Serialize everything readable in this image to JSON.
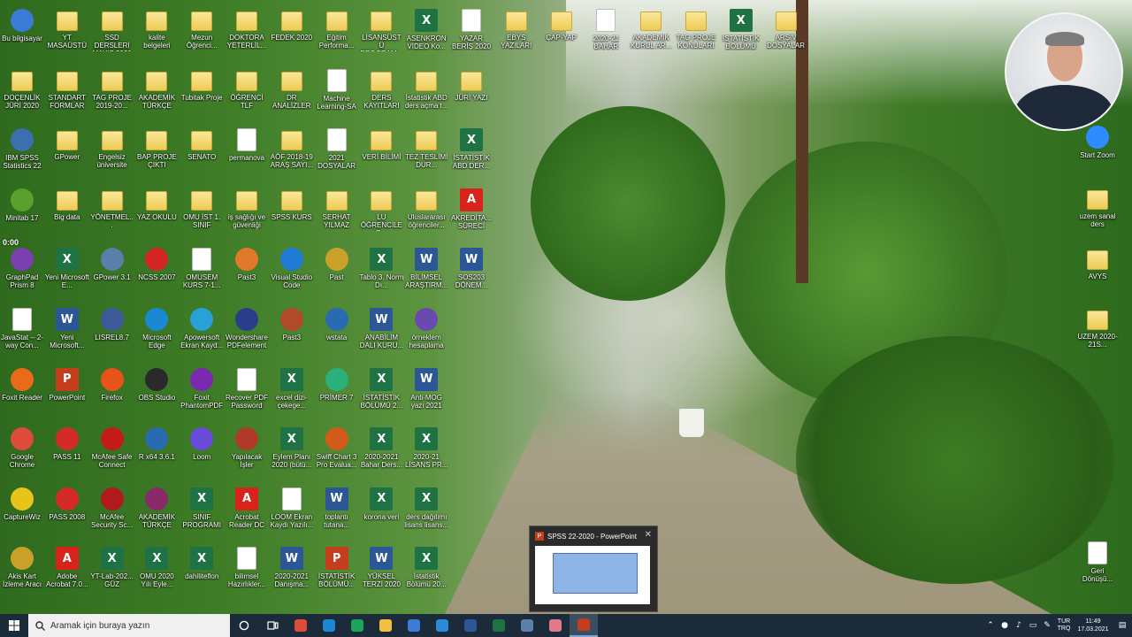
{
  "desktop": {
    "rows": [
      [
        {
          "label": "Bu bilgisayar",
          "type": "app",
          "color": "#3a7bd5"
        },
        {
          "label": "YT MASAÜSTÜ",
          "type": "folder"
        },
        {
          "label": "SSD DERSLERİ MAYIS 2020",
          "type": "folder"
        },
        {
          "label": "kalite belgeleri",
          "type": "folder"
        },
        {
          "label": "Mezun Öğrenci...",
          "type": "folder"
        },
        {
          "label": "DOKTORA YETERLİL...",
          "type": "folder"
        },
        {
          "label": "FEDEK 2020",
          "type": "folder"
        },
        {
          "label": "Eğitim Performa...",
          "type": "folder"
        },
        {
          "label": "LİSANSÜSTÜ PROGRAM...",
          "type": "folder"
        },
        {
          "label": "ASENKRON VİDEO Ko...",
          "type": "excel"
        },
        {
          "label": "YAZAR BERİŞ 2020",
          "type": "file"
        },
        {
          "label": "EBYS YAZILARI",
          "type": "folder"
        },
        {
          "label": "ÇAP-YAP",
          "type": "folder"
        },
        {
          "label": "2020-21 BAHAR",
          "type": "file"
        },
        {
          "label": "AKADEMİK KURUL AR...",
          "type": "folder"
        },
        {
          "label": "TAG PROJE KONULARI",
          "type": "folder"
        },
        {
          "label": "İSTATİSTİK BÖLÜMÜ",
          "type": "excel"
        },
        {
          "label": "ARŞİV DOSYALAR",
          "type": "folder"
        }
      ],
      [
        {
          "label": "DOÇENLİK JÜRİ 2020",
          "type": "folder"
        },
        {
          "label": "STANDART FORMLAR",
          "type": "folder"
        },
        {
          "label": "TAG PROJE 2019-20...",
          "type": "folder"
        },
        {
          "label": "AKADEMİK TÜRKÇE",
          "type": "folder"
        },
        {
          "label": "Tubitak Proje",
          "type": "folder"
        },
        {
          "label": "ÖĞRENCİ TLF",
          "type": "folder"
        },
        {
          "label": "DR ANALİZLER",
          "type": "folder"
        },
        {
          "label": "Machine Learning-SA",
          "type": "file"
        },
        {
          "label": "DERS KAYITLARI",
          "type": "folder"
        },
        {
          "label": "İstatistik ABD ders açma t...",
          "type": "folder"
        },
        {
          "label": "JÜRİ YAZI",
          "type": "folder"
        }
      ],
      [
        {
          "label": "IBM SPSS Statistics 22",
          "type": "app",
          "color": "#3b6fb0"
        },
        {
          "label": "GPower",
          "type": "folder"
        },
        {
          "label": "Engelsiz üniversite",
          "type": "folder"
        },
        {
          "label": "BAP PROJE ÇIKTI",
          "type": "folder"
        },
        {
          "label": "SENATO",
          "type": "folder"
        },
        {
          "label": "permanova",
          "type": "file"
        },
        {
          "label": "AÖF 2018-19 ARAŞ SAYI...",
          "type": "folder"
        },
        {
          "label": "2021 DOSYALAR",
          "type": "file"
        },
        {
          "label": "VERİ BİLİMİ",
          "type": "folder"
        },
        {
          "label": "TEZ TESLİMİ DUR...",
          "type": "folder"
        },
        {
          "label": "İSTATİSTİK ABD DER...",
          "type": "excel"
        }
      ],
      [
        {
          "label": "Minitab 17",
          "type": "app",
          "color": "#5aa02c"
        },
        {
          "label": "Big data",
          "type": "folder"
        },
        {
          "label": "YÖNETMEL...",
          "type": "folder"
        },
        {
          "label": "YAZ OKULU",
          "type": "folder"
        },
        {
          "label": "OMU İST 1. SINIF",
          "type": "folder"
        },
        {
          "label": "iş sağlığı ve güvenliği",
          "type": "folder"
        },
        {
          "label": "SPSS KURS",
          "type": "folder"
        },
        {
          "label": "SERHAT YILMAZ",
          "type": "folder"
        },
        {
          "label": "LU ÖĞRENCİLER...",
          "type": "folder"
        },
        {
          "label": "Uluslararası öğrenciler...",
          "type": "folder"
        },
        {
          "label": "AKREDİTA... SÜRECİ",
          "type": "pdf"
        }
      ],
      [
        {
          "label": "GraphPad Prism 8",
          "type": "app",
          "color": "#7a3fb0"
        },
        {
          "label": "Yeni Microsoft E...",
          "type": "excel"
        },
        {
          "label": "GPower 3.1",
          "type": "app",
          "color": "#5a7fa8"
        },
        {
          "label": "NCSS 2007",
          "type": "app",
          "color": "#d42424"
        },
        {
          "label": "OMUSEM KURS 7-1...",
          "type": "file"
        },
        {
          "label": "Past3",
          "type": "app",
          "color": "#e07a2a"
        },
        {
          "label": "Visual Studio Code",
          "type": "app",
          "color": "#1f7ad4"
        },
        {
          "label": "Past",
          "type": "app",
          "color": "#c9a02a"
        },
        {
          "label": "Tablo 3. Norm Dı...",
          "type": "excel"
        },
        {
          "label": "BİLİMSEL ARAŞTIRM...",
          "type": "word"
        },
        {
          "label": "SOS203 DÖNEM...",
          "type": "word"
        }
      ],
      [
        {
          "label": "JavaStat -- 2-way Con...",
          "type": "file"
        },
        {
          "label": "Yeni Microsoft...",
          "type": "word"
        },
        {
          "label": "LISREL8.7",
          "type": "app",
          "color": "#3c5a9a"
        },
        {
          "label": "Microsoft Edge",
          "type": "app",
          "color": "#1b88d2"
        },
        {
          "label": "Apowersoft Ekran Kayd...",
          "type": "app",
          "color": "#2aa0d8"
        },
        {
          "label": "Wondershare PDFelement",
          "type": "app",
          "color": "#2a3d8a"
        },
        {
          "label": "Past3",
          "type": "app",
          "color": "#b04a2a"
        },
        {
          "label": "wstata",
          "type": "app",
          "color": "#2a6ab0"
        },
        {
          "label": "ANABİLİM DALI KURU...",
          "type": "word"
        },
        {
          "label": "örneklem hesaplama",
          "type": "app",
          "color": "#6a4ab0"
        }
      ],
      [
        {
          "label": "Foxit Reader",
          "type": "app",
          "color": "#e86a1a"
        },
        {
          "label": "PowerPoint",
          "type": "ppt"
        },
        {
          "label": "Firefox",
          "type": "app",
          "color": "#e8531a"
        },
        {
          "label": "OBS Studio",
          "type": "app",
          "color": "#2a2a2a"
        },
        {
          "label": "Foxit PhantomPDF",
          "type": "app",
          "color": "#7a2ab0"
        },
        {
          "label": "Recover PDF Password",
          "type": "file"
        },
        {
          "label": "excel dizi-çekege...",
          "type": "excel"
        },
        {
          "label": "PRİMER 7",
          "type": "app",
          "color": "#2ab07a"
        },
        {
          "label": "İSTATİSTİK BÖLÜMÜ 2...",
          "type": "excel"
        },
        {
          "label": "Anti-MOG yazı 2021",
          "type": "word"
        }
      ],
      [
        {
          "label": "Google Chrome",
          "type": "app",
          "color": "#dd4b39"
        },
        {
          "label": "PASS 11",
          "type": "app",
          "color": "#d42a2a"
        },
        {
          "label": "McAfee Safe Connect",
          "type": "app",
          "color": "#c41a1a"
        },
        {
          "label": "R x64 3.6.1",
          "type": "app",
          "color": "#2a6ab0"
        },
        {
          "label": "Loom",
          "type": "app",
          "color": "#6a4ad8"
        },
        {
          "label": "Yapılacak İşler",
          "type": "app",
          "color": "#b03a2a"
        },
        {
          "label": "Eylem Planı 2020 (bütü...",
          "type": "excel"
        },
        {
          "label": "Swiff Chart 3 Pro Evalua...",
          "type": "app",
          "color": "#d45a1a"
        },
        {
          "label": "2020-2021 Bahar Ders...",
          "type": "excel"
        },
        {
          "label": "2020-21 LİSANS PR...",
          "type": "excel"
        }
      ],
      [
        {
          "label": "CaptureWiz",
          "type": "app",
          "color": "#e8c41a"
        },
        {
          "label": "PASS 2008",
          "type": "app",
          "color": "#d42a2a"
        },
        {
          "label": "McAfee Security Sc...",
          "type": "app",
          "color": "#b01a1a"
        },
        {
          "label": "AKADEMİK TÜRKÇE",
          "type": "app",
          "color": "#8a2a6a"
        },
        {
          "label": "SINIF PROGRAMI",
          "type": "excel"
        },
        {
          "label": "Acrobat Reader DC",
          "type": "pdf"
        },
        {
          "label": "LOOM Ekran Kaydı Yazılı...",
          "type": "file"
        },
        {
          "label": "toplantı tutana...",
          "type": "word"
        },
        {
          "label": "korona veri",
          "type": "excel"
        },
        {
          "label": "ders dağılımı lisans lisans...",
          "type": "excel"
        }
      ],
      [
        {
          "label": "Akis Kart İzleme Aracı",
          "type": "app",
          "color": "#c9a02a"
        },
        {
          "label": "Adobe Acrobat 7.0...",
          "type": "pdf"
        },
        {
          "label": "YT-Lab-202... GÜZ",
          "type": "excel"
        },
        {
          "label": "OMU 2020 Yılı Eyle...",
          "type": "excel"
        },
        {
          "label": "dahiliteflon",
          "type": "excel"
        },
        {
          "label": "bilimsel Hazırlıkler...",
          "type": "file"
        },
        {
          "label": "2020-2021 Danışma...",
          "type": "word"
        },
        {
          "label": "İSTATİSTİK BÖLÜMÜ...",
          "type": "ppt"
        },
        {
          "label": "YÜKSEL TERZİ 2020",
          "type": "word"
        },
        {
          "label": "İstatistik Bölümü 20...",
          "type": "excel"
        }
      ]
    ],
    "right_icons": [
      {
        "label": "Start Zoom",
        "type": "app",
        "color": "#2d8cff"
      },
      {
        "label": "uzem sanal ders",
        "type": "folder"
      },
      {
        "label": "AVYS",
        "type": "folder"
      },
      {
        "label": "UZEM 2020-21S...",
        "type": "folder"
      },
      {
        "label": "Geri Dönüşü...",
        "type": "file"
      }
    ],
    "overlay_time": "0:00"
  },
  "ppt_preview": {
    "title": "SPSS 22-2020 - PowerPoint",
    "badge": "P"
  },
  "taskbar": {
    "search_placeholder": "Aramak için buraya yazın",
    "apps": [
      {
        "name": "chrome",
        "color": "#dd4b39",
        "active": false
      },
      {
        "name": "edge-beta",
        "color": "#1b88d2",
        "active": false
      },
      {
        "name": "edge",
        "color": "#1aa35a",
        "active": false
      },
      {
        "name": "file-explorer",
        "color": "#f0c040",
        "active": false
      },
      {
        "name": "store",
        "color": "#3a7bd5",
        "active": false
      },
      {
        "name": "mail",
        "color": "#2a8ad8",
        "active": false
      },
      {
        "name": "word",
        "color": "#2b5797",
        "active": false
      },
      {
        "name": "excel",
        "color": "#1f7244",
        "active": false
      },
      {
        "name": "calculator",
        "color": "#5a7fa8",
        "active": false
      },
      {
        "name": "paint",
        "color": "#e07a8a",
        "active": false
      },
      {
        "name": "powerpoint",
        "color": "#c43e1c",
        "active": true
      }
    ],
    "lang_top": "TUR",
    "lang_bottom": "TRQ",
    "time": "11:49",
    "date": "17.03.2021"
  }
}
